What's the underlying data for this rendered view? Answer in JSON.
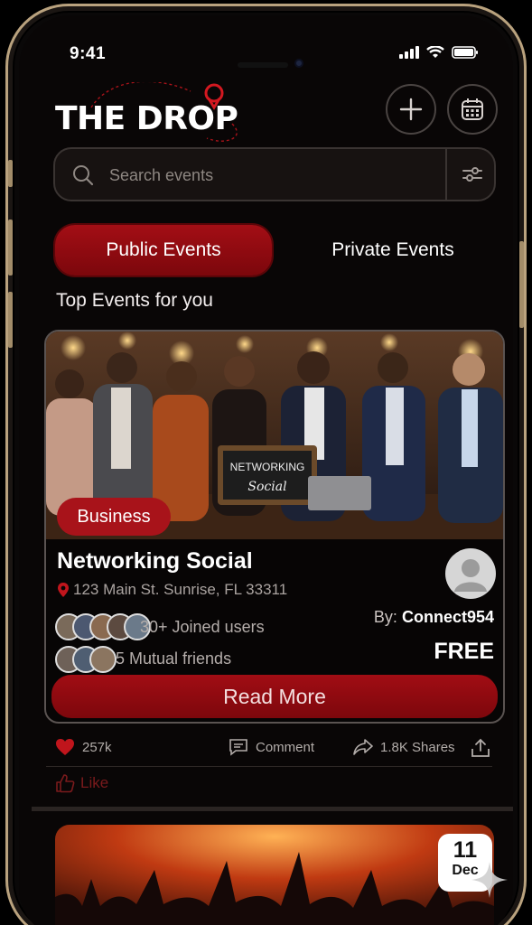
{
  "status_bar": {
    "time": "9:41"
  },
  "app": {
    "logo_text": "THE DROP"
  },
  "header": {
    "add_icon": "plus-icon",
    "calendar_icon": "calendar-icon"
  },
  "search": {
    "placeholder": "Search events",
    "filter_icon": "filter-sliders-icon"
  },
  "tabs": [
    {
      "label": "Public Events",
      "active": true
    },
    {
      "label": "Private Events",
      "active": false
    }
  ],
  "section_title": "Top Events for you",
  "featured_event": {
    "category": "Business",
    "sign_line1": "NETWORKING",
    "sign_line2": "Social",
    "title": "Networking Social",
    "address": "123 Main St. Sunrise, FL 33311",
    "joined_text": "30+ Joined users",
    "mutual_text": "5 Mutual friends",
    "by_label": "By:",
    "host": "Connect954",
    "price": "FREE",
    "cta": "Read More"
  },
  "engagement": {
    "likes": "257k",
    "comment_label": "Comment",
    "shares": "1.8K Shares",
    "like_label": "Like"
  },
  "next_event": {
    "day": "11",
    "month": "Dec"
  },
  "colors": {
    "accent": "#a30e15",
    "background": "#090606",
    "frame": "#b9a27e"
  }
}
